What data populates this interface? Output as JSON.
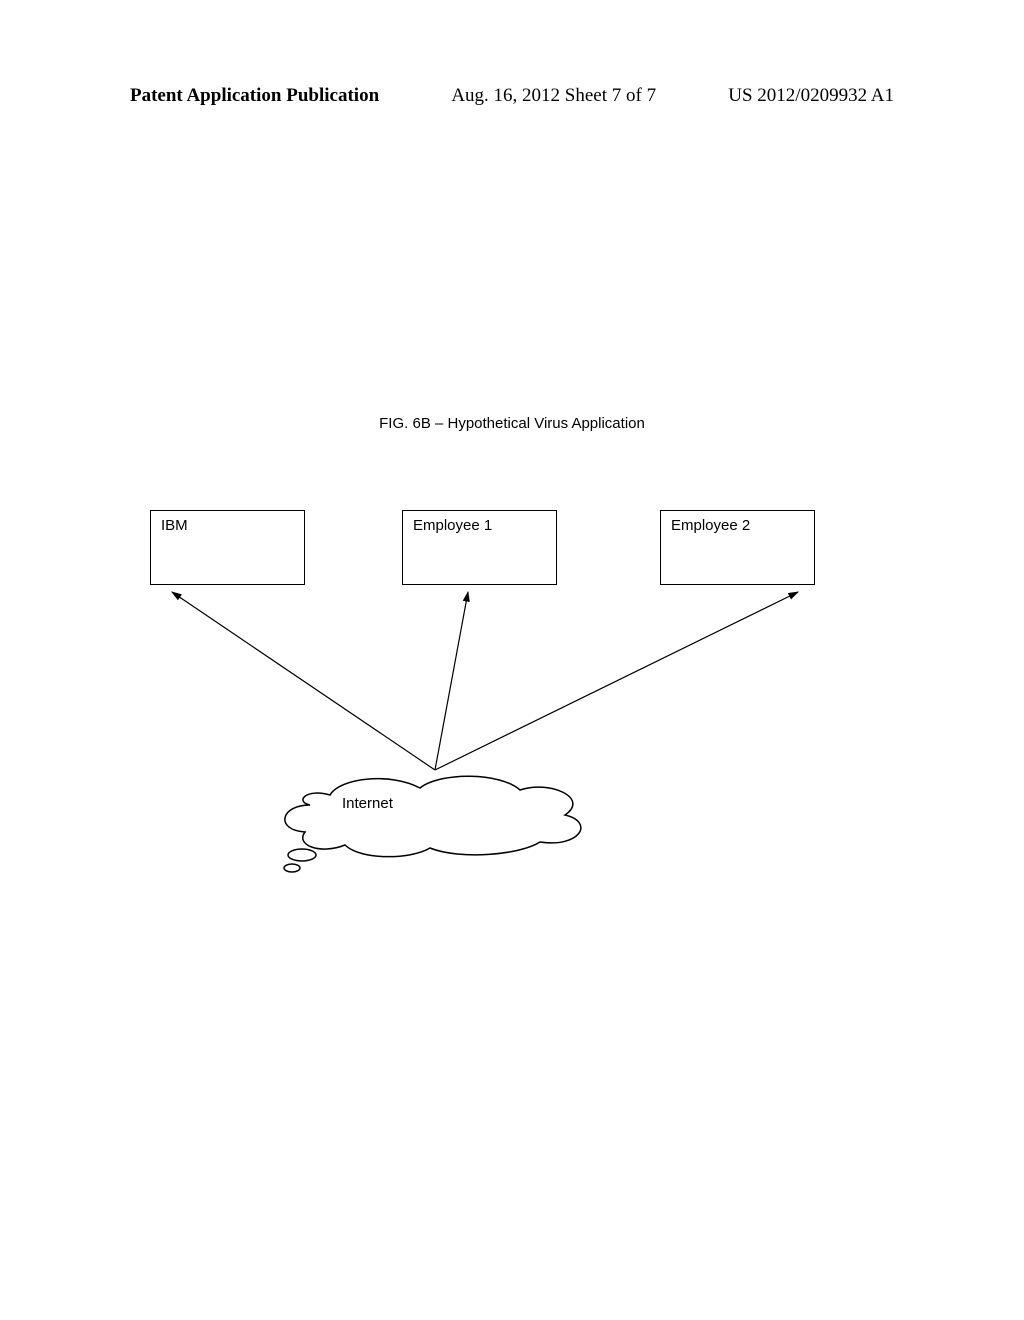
{
  "header": {
    "left": "Patent Application Publication",
    "center": "Aug. 16, 2012   Sheet 7 of 7",
    "right": "US 2012/0209932 A1"
  },
  "figure": {
    "caption": "FIG. 6B – Hypothetical Virus Application"
  },
  "diagram": {
    "boxes": {
      "ibm": "IBM",
      "employee1": "Employee 1",
      "employee2": "Employee 2"
    },
    "cloud": "Internet"
  }
}
